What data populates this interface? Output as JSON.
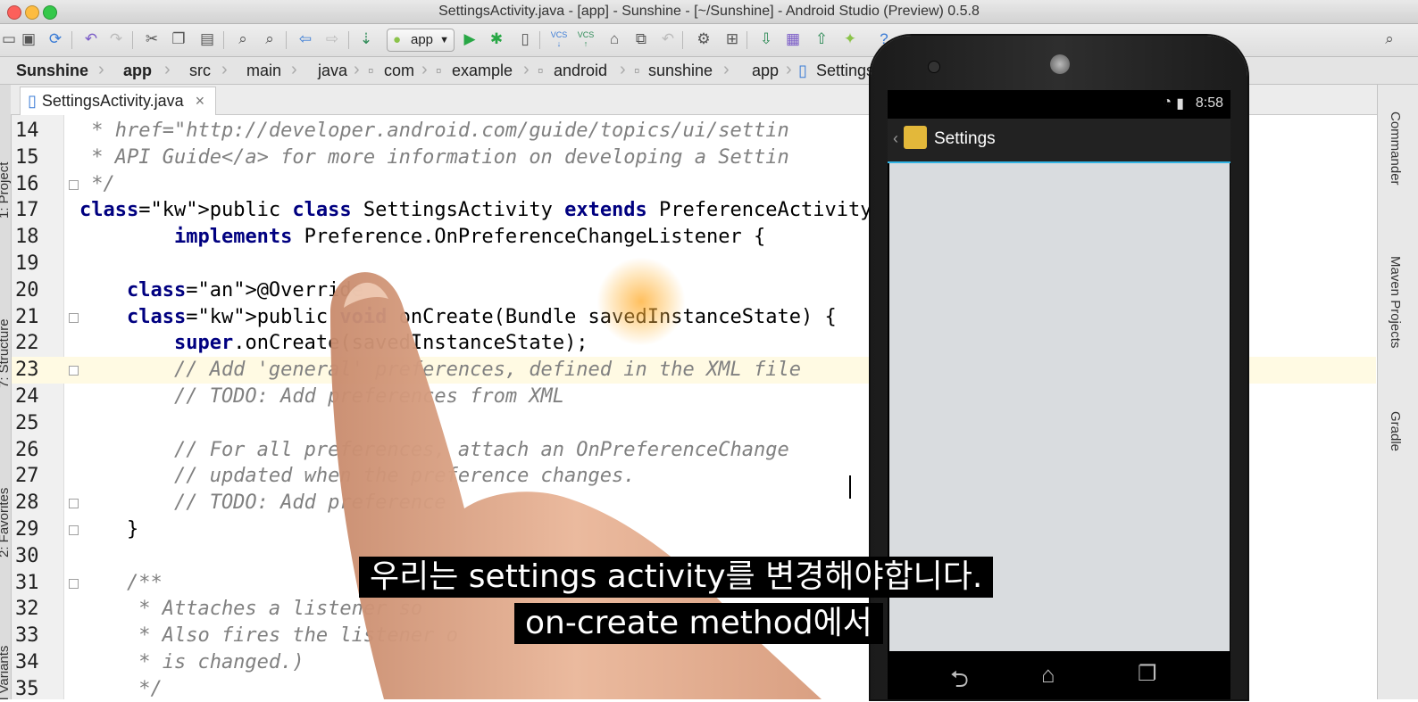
{
  "window": {
    "title": "SettingsActivity.java - [app] - Sunshine - [~/Sunshine] - Android Studio (Preview) 0.5.8",
    "traffic_lights": [
      "#fc605b",
      "#fdbc40",
      "#34c84a"
    ]
  },
  "toolbar": {
    "run_config_label": "app",
    "vcs_label": "VCS",
    "icons": [
      "project-icon",
      "save-icon",
      "sync-icon",
      "undo-icon",
      "redo-icon",
      "cut-icon",
      "copy-icon",
      "paste-icon",
      "find-icon",
      "replace-icon",
      "back-icon",
      "forward-icon",
      "make-icon",
      "run-config-android-icon",
      "run-icon",
      "debug-icon",
      "attach-debugger-icon",
      "vcs-update-icon",
      "vcs-commit-icon",
      "vcs-history-icon",
      "vcs-compare-icon",
      "vcs-revert-icon",
      "settings-icon",
      "project-structure-icon",
      "sdk-manager-icon",
      "avd-manager-icon",
      "sync-gradle-icon",
      "device-monitor-icon",
      "help-icon",
      "search-icon"
    ]
  },
  "breadcrumb": [
    "Sunshine",
    "app",
    "src",
    "main",
    "java",
    "com",
    "example",
    "android",
    "sunshine",
    "app",
    "Settings"
  ],
  "editor_tab": {
    "label": "SettingsActivity.java",
    "close": "×"
  },
  "tool_windows": {
    "left": [
      "1: Project",
      "7: Structure",
      "2: Favorites",
      "Build Variants"
    ],
    "right": [
      "Commander",
      "Maven Projects",
      "Gradle"
    ]
  },
  "code_lines": [
    {
      "num": "14",
      "text": " * href=\"http://developer.android.com/guide/topics/ui/settin"
    },
    {
      "num": "15",
      "text": " * API Guide</a> for more information on developing a Settin"
    },
    {
      "num": "16",
      "text": " */"
    },
    {
      "num": "17",
      "text": "public class SettingsActivity extends PreferenceActivity"
    },
    {
      "num": "18",
      "text": "        implements Preference.OnPreferenceChangeListener {"
    },
    {
      "num": "19",
      "text": ""
    },
    {
      "num": "20",
      "text": "    @Override"
    },
    {
      "num": "21",
      "text": "    public void onCreate(Bundle savedInstanceState) {"
    },
    {
      "num": "22",
      "text": "        super.onCreate(savedInstanceState);"
    },
    {
      "num": "23",
      "text": "        // Add 'general' preferences, defined in the XML file"
    },
    {
      "num": "24",
      "text": "        // TODO: Add preferences from XML"
    },
    {
      "num": "25",
      "text": ""
    },
    {
      "num": "26",
      "text": "        // For all preferences, attach an OnPreferenceChange                      an be"
    },
    {
      "num": "27",
      "text": "        // updated when the preference changes."
    },
    {
      "num": "28",
      "text": "        // TODO: Add preference"
    },
    {
      "num": "29",
      "text": "    }"
    },
    {
      "num": "30",
      "text": ""
    },
    {
      "num": "31",
      "text": "    /**"
    },
    {
      "num": "32",
      "text": "     * Attaches a listener so"
    },
    {
      "num": "33",
      "text": "     * Also fires the listener o                                              e value"
    },
    {
      "num": "34",
      "text": "     * is changed.)"
    },
    {
      "num": "35",
      "text": "     */"
    }
  ],
  "phone": {
    "status_time": "8:58",
    "app_title": "Settings",
    "accent": "#33b5e5"
  },
  "subtitles": {
    "line1": "우리는 settings activity를 변경해야합니다.",
    "line2": "on-create method에서"
  }
}
